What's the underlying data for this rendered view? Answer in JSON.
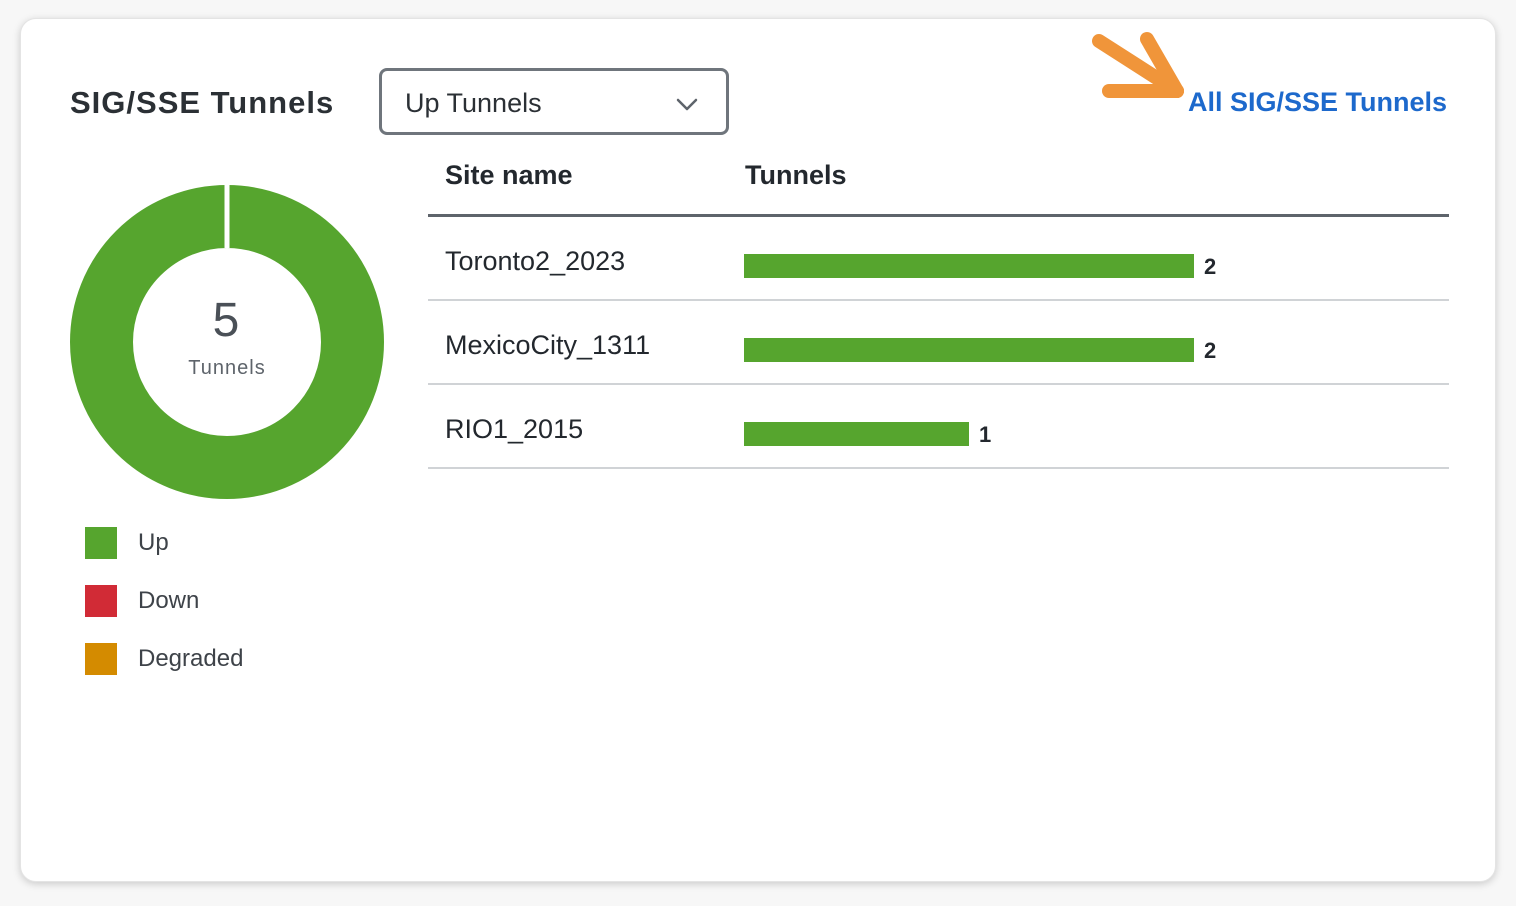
{
  "widget": {
    "title": "SIG/SSE Tunnels",
    "filter_selected": "Up Tunnels",
    "all_link": "All SIG/SSE Tunnels"
  },
  "donut": {
    "total": "5",
    "label": "Tunnels",
    "up_color": "#56a52e",
    "segments": [
      {
        "status": "Up",
        "value": 5
      }
    ]
  },
  "legend": [
    {
      "label": "Up",
      "color": "#56a52e"
    },
    {
      "label": "Down",
      "color": "#d12b36"
    },
    {
      "label": "Degraded",
      "color": "#d48b00"
    }
  ],
  "table": {
    "headers": [
      "Site name",
      "Tunnels"
    ],
    "max": 2,
    "rows": [
      {
        "site": "Toronto2_2023",
        "tunnels": 2
      },
      {
        "site": "MexicoCity_1311",
        "tunnels": 2
      },
      {
        "site": "RIO1_2015",
        "tunnels": 1
      }
    ]
  },
  "annotation": {
    "arrow_color": "#f0953a"
  }
}
